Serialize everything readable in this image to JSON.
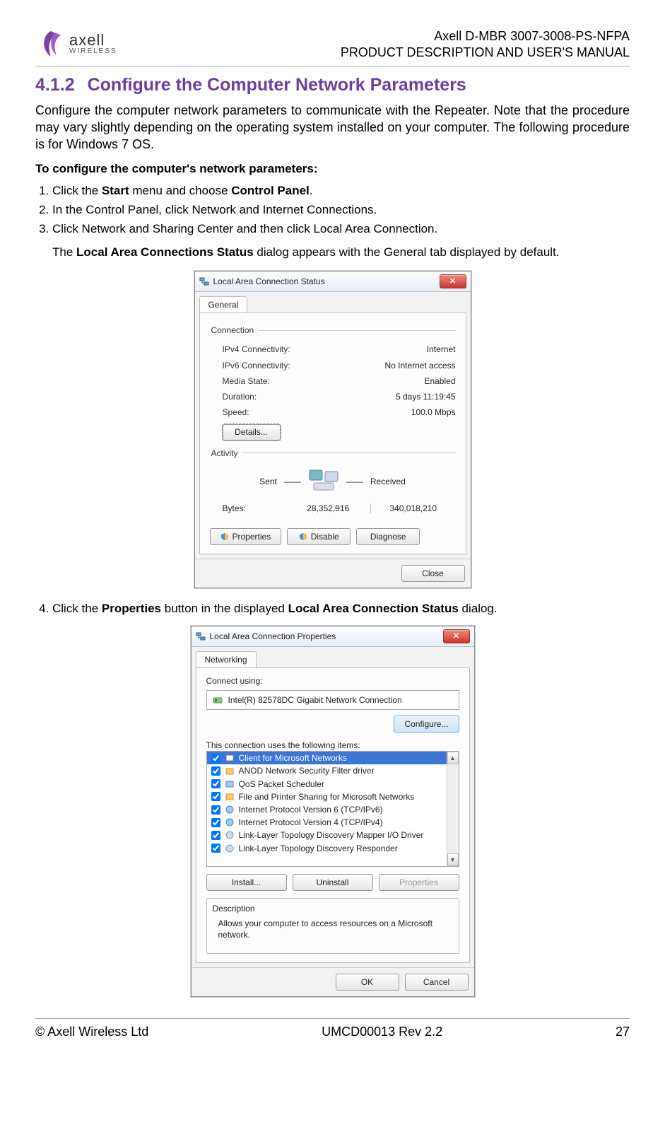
{
  "header": {
    "logo_brand": "axell",
    "logo_sub": "WIRELESS",
    "line1": "Axell D-MBR 3007-3008-PS-NFPA",
    "line2": "PRODUCT DESCRIPTION AND USER'S MANUAL"
  },
  "section": {
    "number": "4.1.2",
    "title": "Configure the Computer Network Parameters",
    "intro": "Configure the computer network parameters to communicate with the Repeater. Note that the procedure may vary slightly depending on the operating system installed on your computer. The following procedure is for Windows 7 OS.",
    "subhead": "To configure the computer's network parameters:",
    "step1_a": "Click the ",
    "step1_b": "Start",
    "step1_c": " menu and choose ",
    "step1_d": "Control Panel",
    "step1_e": ".",
    "step2": "In the Control Panel, click Network and Internet Connections.",
    "step3": "Click Network and Sharing Center and then click Local Area Connection.",
    "step3_note_a": "The ",
    "step3_note_b": "Local Area Connections Status",
    "step3_note_c": " dialog appears with the General tab displayed by default.",
    "step4_a": "Click the ",
    "step4_b": "Properties",
    "step4_c": " button in the displayed ",
    "step4_d": "Local Area Connection Status",
    "step4_e": " dialog."
  },
  "dialog1": {
    "title": "Local Area Connection Status",
    "tab": "General",
    "group_conn": "Connection",
    "rows": [
      {
        "k": "IPv4 Connectivity:",
        "v": "Internet"
      },
      {
        "k": "IPv6 Connectivity:",
        "v": "No Internet access"
      },
      {
        "k": "Media State:",
        "v": "Enabled"
      },
      {
        "k": "Duration:",
        "v": "5 days 11:19:45"
      },
      {
        "k": "Speed:",
        "v": "100.0 Mbps"
      }
    ],
    "details_btn": "Details...",
    "group_act": "Activity",
    "sent": "Sent",
    "received": "Received",
    "bytes_label": "Bytes:",
    "bytes_sent": "28,352,916",
    "bytes_recv": "340,018,210",
    "btn_props": "Properties",
    "btn_disable": "Disable",
    "btn_diagnose": "Diagnose",
    "btn_close": "Close"
  },
  "dialog2": {
    "title": "Local Area Connection Properties",
    "tab": "Networking",
    "connect_using": "Connect using:",
    "adapter": "Intel(R) 82578DC Gigabit Network Connection",
    "btn_configure": "Configure...",
    "items_label": "This connection uses the following items:",
    "items": [
      "Client for Microsoft Networks",
      "ANOD Network Security Filter driver",
      "QoS Packet Scheduler",
      "File and Printer Sharing for Microsoft Networks",
      "Internet Protocol Version 6 (TCP/IPv6)",
      "Internet Protocol Version 4 (TCP/IPv4)",
      "Link-Layer Topology Discovery Mapper I/O Driver",
      "Link-Layer Topology Discovery Responder"
    ],
    "btn_install": "Install...",
    "btn_uninstall": "Uninstall",
    "btn_properties": "Properties",
    "desc_label": "Description",
    "desc_text": "Allows your computer to access resources on a Microsoft network.",
    "btn_ok": "OK",
    "btn_cancel": "Cancel"
  },
  "footer": {
    "left": "© Axell Wireless Ltd",
    "center": "UMCD00013 Rev 2.2",
    "right": "27"
  }
}
